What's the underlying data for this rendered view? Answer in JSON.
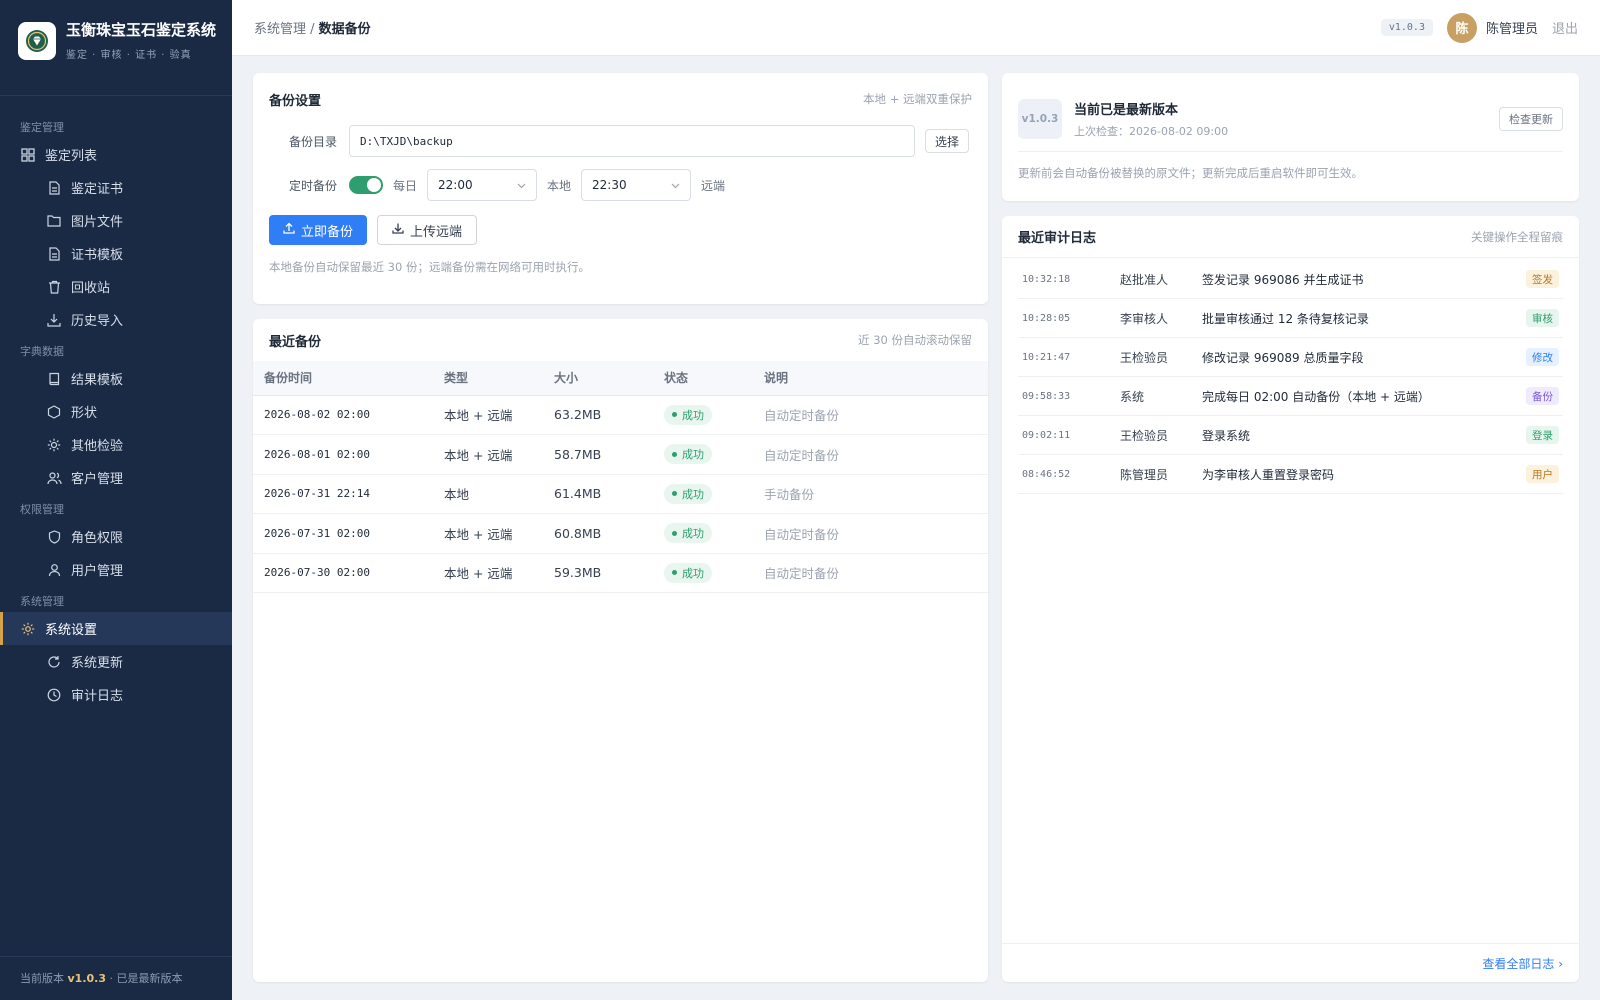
{
  "brand": {
    "title": "玉衡珠宝玉石鉴定系统",
    "subtitle": "鉴定 · 审核 · 证书 · 验真"
  },
  "sidebar": {
    "groups": [
      {
        "label": "鉴定管理"
      },
      {
        "label": "字典数据"
      },
      {
        "label": "权限管理"
      },
      {
        "label": "系统管理"
      }
    ],
    "items": [
      {
        "label": "鉴定列表",
        "icon": "grid-icon"
      },
      {
        "label": "鉴定证书",
        "icon": "document-icon"
      },
      {
        "label": "图片文件",
        "icon": "folder-icon"
      },
      {
        "label": "证书模板",
        "icon": "document-icon"
      },
      {
        "label": "回收站",
        "icon": "trash-icon"
      },
      {
        "label": "历史导入",
        "icon": "download-icon"
      },
      {
        "label": "结果模板",
        "icon": "book-icon"
      },
      {
        "label": "形状",
        "icon": "hexagon-icon"
      },
      {
        "label": "其他检验",
        "icon": "sun-icon"
      },
      {
        "label": "客户管理",
        "icon": "users-icon"
      },
      {
        "label": "角色权限",
        "icon": "shield-icon"
      },
      {
        "label": "用户管理",
        "icon": "user-icon"
      },
      {
        "label": "系统设置",
        "icon": "gear-icon"
      },
      {
        "label": "系统更新",
        "icon": "refresh-icon"
      },
      {
        "label": "审计日志",
        "icon": "clock-icon"
      }
    ],
    "footer_prefix": "当前版本 ",
    "footer_version": "v1.0.3",
    "footer_suffix": " · 已是最新版本"
  },
  "topbar": {
    "crumb_parent": "系统管理 / ",
    "crumb_current": "数据备份",
    "version": "v1.0.3",
    "avatar": "陈",
    "user": "陈管理员",
    "logout": "退出"
  },
  "backup_settings": {
    "title": "备份设置",
    "hint": "本地 + 远端双重保护",
    "dir_label": "备份目录",
    "dir_value": "D:\\TXJD\\backup",
    "choose": "选择",
    "schedule_label": "定时备份",
    "daily": "每日",
    "local_time": "22:00",
    "local": "本地",
    "remote_time": "22:30",
    "remote": "远端",
    "backup_now": "立即备份",
    "upload_remote": "上传远端",
    "note": "本地备份自动保留最近 30 份；远端备份需在网络可用时执行。"
  },
  "recent_backups": {
    "title": "最近备份",
    "hint": "近 30 份自动滚动保留",
    "columns": [
      "备份时间",
      "类型",
      "大小",
      "状态",
      "说明"
    ],
    "rows": [
      {
        "time": "2026-08-02 02:00",
        "type": "本地 + 远端",
        "size": "63.2MB",
        "status": "成功",
        "desc": "自动定时备份"
      },
      {
        "time": "2026-08-01 02:00",
        "type": "本地 + 远端",
        "size": "58.7MB",
        "status": "成功",
        "desc": "自动定时备份"
      },
      {
        "time": "2026-07-31 22:14",
        "type": "本地",
        "size": "61.4MB",
        "status": "成功",
        "desc": "手动备份"
      },
      {
        "time": "2026-07-31 02:00",
        "type": "本地 + 远端",
        "size": "60.8MB",
        "status": "成功",
        "desc": "自动定时备份"
      },
      {
        "time": "2026-07-30 02:00",
        "type": "本地 + 远端",
        "size": "59.3MB",
        "status": "成功",
        "desc": "自动定时备份"
      }
    ]
  },
  "version_card": {
    "badge": "v1.0.3",
    "title": "当前已是最新版本",
    "last_check": "上次检查：2026-08-02 09:00",
    "check_button": "检查更新",
    "note": "更新前会自动备份被替换的原文件；更新完成后重启软件即可生效。"
  },
  "audit_log": {
    "title": "最近审计日志",
    "hint": "关键操作全程留痕",
    "view_all": "查看全部日志 ›",
    "rows": [
      {
        "time": "10:32:18",
        "user": "赵批准人",
        "text": "签发记录 969086 并生成证书",
        "tag": "签发",
        "tag_bg": "#fbf1dd",
        "tag_fg": "#b7791f"
      },
      {
        "time": "10:28:05",
        "user": "李审核人",
        "text": "批量审核通过 12 条待复核记录",
        "tag": "审核",
        "tag_bg": "#e6f6ee",
        "tag_fg": "#2f9e6e"
      },
      {
        "time": "10:21:47",
        "user": "王检验员",
        "text": "修改记录 969089 总质量字段",
        "tag": "修改",
        "tag_bg": "#e7f0fe",
        "tag_fg": "#2f7ef6"
      },
      {
        "time": "09:58:33",
        "user": "系统",
        "text": "完成每日 02:00 自动备份（本地 + 远端）",
        "tag": "备份",
        "tag_bg": "#efeafd",
        "tag_fg": "#7c5bd6"
      },
      {
        "time": "09:02:11",
        "user": "王检验员",
        "text": "登录系统",
        "tag": "登录",
        "tag_bg": "#e6f6ee",
        "tag_fg": "#2f9e6e"
      },
      {
        "time": "08:46:52",
        "user": "陈管理员",
        "text": "为李审核人重置登录密码",
        "tag": "用户",
        "tag_bg": "#fbf1dd",
        "tag_fg": "#b7791f"
      }
    ]
  },
  "colors": {
    "sidebar_bg": "#1b2a44",
    "accent": "#2f7ef6",
    "success": "#2f9e6e",
    "gold": "#d4a24c"
  }
}
